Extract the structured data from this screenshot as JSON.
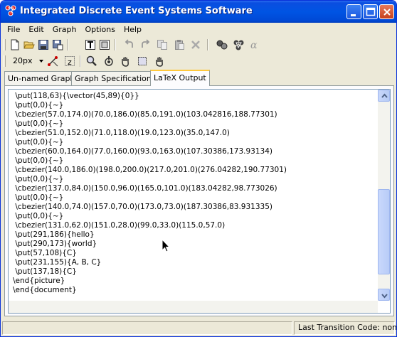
{
  "window": {
    "title": "Integrated Discrete Event Systems Software"
  },
  "menubar": {
    "items": [
      "File",
      "Edit",
      "Graph",
      "Options",
      "Help"
    ]
  },
  "toolbar": {
    "zoom_value": "20px",
    "icons": [
      "new-file-icon",
      "open-folder-icon",
      "save-icon",
      "save-as-icon",
      "text-tool-icon",
      "copy-text-icon",
      "undo-icon",
      "redo-icon",
      "copy-icon",
      "paste-icon",
      "delete-icon",
      "automaton-icon",
      "automaton-alt-icon",
      "alpha-icon",
      "zoom-in-icon",
      "select-node-icon",
      "create-node-icon",
      "move-icon",
      "select-area-icon",
      "hand-icon"
    ]
  },
  "tabs": [
    {
      "label": "Un-named Graph"
    },
    {
      "label": "Graph Specifications"
    },
    {
      "label": "LaTeX Output",
      "active": true
    }
  ],
  "latex_output": {
    "lines": [
      " \\put(118,63){\\vector(45,89){0}}",
      " \\put(0,0){~}",
      " \\cbezier(57.0,174.0)(70.0,186.0)(85.0,191.0)(103.042816,188.77301)",
      " \\put(0,0){~}",
      " \\cbezier(51.0,152.0)(71.0,118.0)(19.0,123.0)(35.0,147.0)",
      " \\put(0,0){~}",
      " \\cbezier(60.0,164.0)(77.0,160.0)(93.0,163.0)(107.30386,173.93134)",
      " \\put(0,0){~}",
      " \\cbezier(140.0,186.0)(198.0,200.0)(217.0,201.0)(276.04282,190.77301)",
      " \\put(0,0){~}",
      " \\cbezier(137.0,84.0)(150.0,96.0)(165.0,101.0)(183.04282,98.773026)",
      " \\put(0,0){~}",
      " \\cbezier(140.0,74.0)(157.0,70.0)(173.0,73.0)(187.30386,83.931335)",
      " \\put(0,0){~}",
      " \\cbezier(131.0,62.0)(151.0,28.0)(99.0,33.0)(115.0,57.0)",
      " \\put(291,186){hello}",
      " \\put(290,173){world}",
      " \\put(57,108){C}",
      " \\put(231,155){A, B, C}",
      " \\put(137,18){C}",
      "\\end{picture}",
      "\\end{document}"
    ]
  },
  "statusbar": {
    "text": "Last Transition Code:  none"
  }
}
